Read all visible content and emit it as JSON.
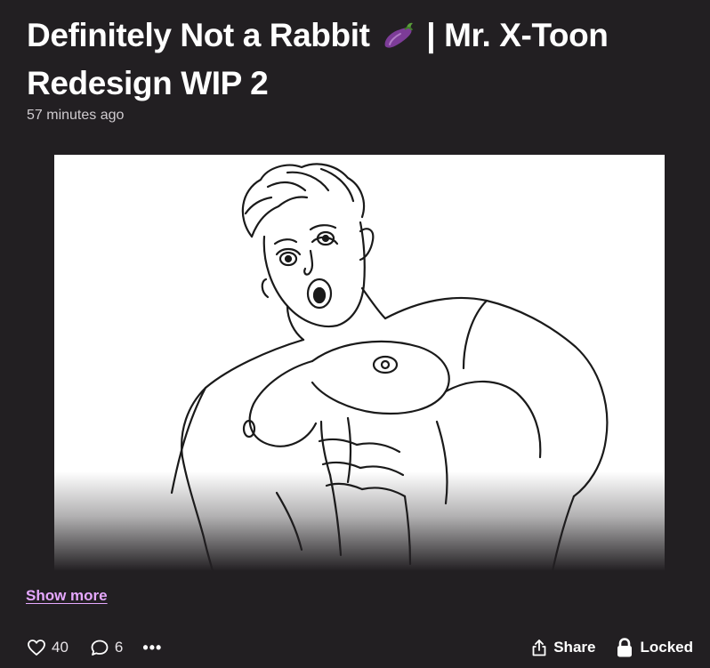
{
  "post": {
    "title_part1": "Definitely Not a Rabbit ",
    "title_emoji": "eggplant-emoji",
    "title_part2": " | Mr. X-Toon Redesign WIP 2",
    "timestamp": "57 minutes ago",
    "image_alt": "line-art sketch of a muscular man, low-angle view",
    "show_more_label": "Show more"
  },
  "actions": {
    "like_icon": "heart-icon",
    "like_count": "40",
    "comment_icon": "comment-icon",
    "comment_count": "6",
    "more_icon": "more-icon",
    "more_label": "•••",
    "share_icon": "share-icon",
    "share_label": "Share",
    "lock_icon": "lock-icon",
    "locked_label": "Locked"
  },
  "colors": {
    "background": "#221f22",
    "text": "#ffffff",
    "muted_text": "#cfcbcf",
    "link": "#e6a8ff"
  }
}
